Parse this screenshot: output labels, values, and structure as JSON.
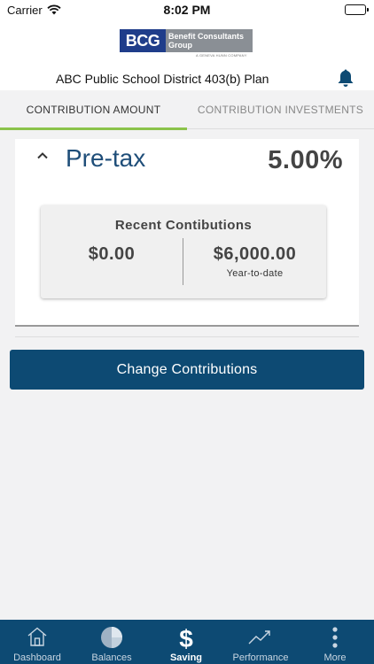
{
  "status_bar": {
    "carrier": "Carrier",
    "time": "8:02 PM"
  },
  "header": {
    "logo_mark": "BCG",
    "logo_name_line1": "Benefit Consultants",
    "logo_name_line2": "Group",
    "logo_sub": "A GENEVA HUNN COMPANY",
    "plan_title": "ABC Public School District 403(b) Plan"
  },
  "tabs": [
    {
      "label": "CONTRIBUTION AMOUNT",
      "active": true
    },
    {
      "label": "CONTRIBUTION INVESTMENTS",
      "active": false
    }
  ],
  "card": {
    "title": "Pre-tax",
    "percentage": "5.00%",
    "recent": {
      "title": "Recent Contibutions",
      "left_value": "$0.00",
      "right_value": "$6,000.00",
      "right_label": "Year-to-date"
    }
  },
  "change_button_label": "Change Contributions",
  "tabbar": [
    {
      "label": "Dashboard",
      "icon": "house-icon",
      "active": false
    },
    {
      "label": "Balances",
      "icon": "pie-chart-icon",
      "active": false
    },
    {
      "label": "Saving",
      "icon": "dollar-icon",
      "active": true
    },
    {
      "label": "Performance",
      "icon": "trend-line-icon",
      "active": false
    },
    {
      "label": "More",
      "icon": "more-vertical-icon",
      "active": false
    }
  ],
  "colors": {
    "brand_blue": "#0d4a73",
    "title_blue": "#1f4e79",
    "tab_accent": "#8bc34a",
    "logo_blue": "#1f3d8a"
  }
}
